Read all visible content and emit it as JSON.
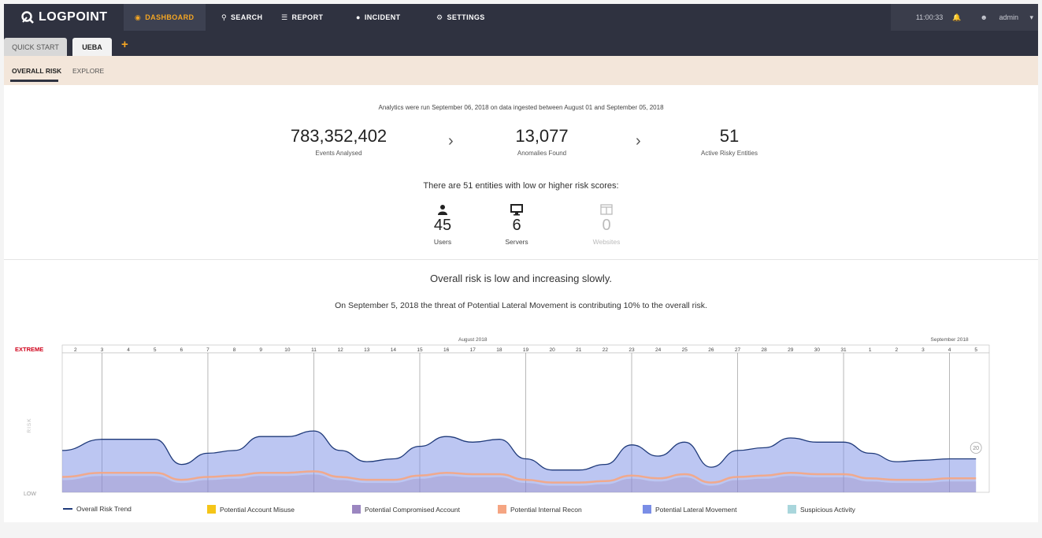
{
  "brand": {
    "name": "LOGPOINT"
  },
  "nav": {
    "items": [
      {
        "label": "DASHBOARD",
        "icon": "dashboard-icon"
      },
      {
        "label": "SEARCH",
        "icon": "search-icon"
      },
      {
        "label": "REPORT",
        "icon": "report-icon"
      },
      {
        "label": "INCIDENT",
        "icon": "incident-icon"
      },
      {
        "label": "SETTINGS",
        "icon": "gear-icon"
      }
    ],
    "time": "11:00:33",
    "user": "admin",
    "accent": "#f5a623"
  },
  "tabs": [
    {
      "label": "QUICK START"
    },
    {
      "label": "UEBA"
    }
  ],
  "subtabs": [
    {
      "label": "OVERALL RISK"
    },
    {
      "label": "EXPLORE"
    }
  ],
  "summary": {
    "caption": "Analytics were run September 06, 2018 on data ingested between August 01 and September 05, 2018",
    "stats": [
      {
        "value": "783,352,402",
        "label": "Events Analysed"
      },
      {
        "value": "13,077",
        "label": "Anomalies Found"
      },
      {
        "value": "51",
        "label": "Active Risky Entities"
      }
    ],
    "entities_line": "There are 51 entities with low or higher risk scores:",
    "entities": [
      {
        "count": "45",
        "label": "Users",
        "icon": "user-icon"
      },
      {
        "count": "6",
        "label": "Servers",
        "icon": "monitor-icon"
      },
      {
        "count": "0",
        "label": "Websites",
        "icon": "browser-window-icon"
      }
    ]
  },
  "risk": {
    "headline": "Overall risk is low and increasing slowly.",
    "subline": "On September 5, 2018 the threat of Potential Lateral Movement is contributing 10% to the overall risk."
  },
  "chart_data": {
    "type": "area",
    "month_labels": [
      {
        "label": "August 2018",
        "at_index": 15
      },
      {
        "label": "September 2018",
        "at_index": 33
      }
    ],
    "x": [
      "2",
      "3",
      "4",
      "5",
      "6",
      "7",
      "8",
      "9",
      "10",
      "11",
      "12",
      "13",
      "14",
      "15",
      "16",
      "17",
      "18",
      "19",
      "20",
      "21",
      "22",
      "23",
      "24",
      "25",
      "26",
      "27",
      "28",
      "29",
      "30",
      "31",
      "1",
      "2",
      "3",
      "4",
      "5"
    ],
    "y_axis": {
      "top_label": "EXTREME",
      "bottom_label": "LOW",
      "title": "RISK"
    },
    "series": [
      {
        "name": "Overall Risk Trend",
        "values": [
          0.3,
          0.38,
          0.38,
          0.38,
          0.2,
          0.28,
          0.3,
          0.4,
          0.4,
          0.44,
          0.3,
          0.22,
          0.24,
          0.33,
          0.4,
          0.36,
          0.38,
          0.24,
          0.16,
          0.16,
          0.2,
          0.34,
          0.26,
          0.36,
          0.18,
          0.3,
          0.32,
          0.39,
          0.36,
          0.36,
          0.28,
          0.22,
          0.23,
          0.24,
          0.24
        ]
      },
      {
        "name": "Potential Internal Recon",
        "values": [
          0.11,
          0.14,
          0.14,
          0.14,
          0.09,
          0.11,
          0.12,
          0.14,
          0.14,
          0.15,
          0.11,
          0.09,
          0.09,
          0.12,
          0.14,
          0.13,
          0.13,
          0.09,
          0.07,
          0.07,
          0.08,
          0.12,
          0.1,
          0.13,
          0.07,
          0.11,
          0.12,
          0.14,
          0.13,
          0.13,
          0.1,
          0.09,
          0.09,
          0.1,
          0.1
        ]
      }
    ],
    "last_point_label": "20",
    "legend": [
      {
        "label": "Overall Risk Trend",
        "kind": "line",
        "color": "#1f3a7a"
      },
      {
        "label": "Potential Account Misuse",
        "kind": "swatch",
        "color": "#f5c518"
      },
      {
        "label": "Potential Compromised Account",
        "kind": "swatch",
        "color": "#9b86c0"
      },
      {
        "label": "Potential Internal Recon",
        "kind": "swatch",
        "color": "#f5a582"
      },
      {
        "label": "Potential Lateral Movement",
        "kind": "swatch",
        "color": "#7a8ee6"
      },
      {
        "label": "Suspicious Activity",
        "kind": "swatch",
        "color": "#a9d6dc"
      }
    ],
    "grid": true
  }
}
